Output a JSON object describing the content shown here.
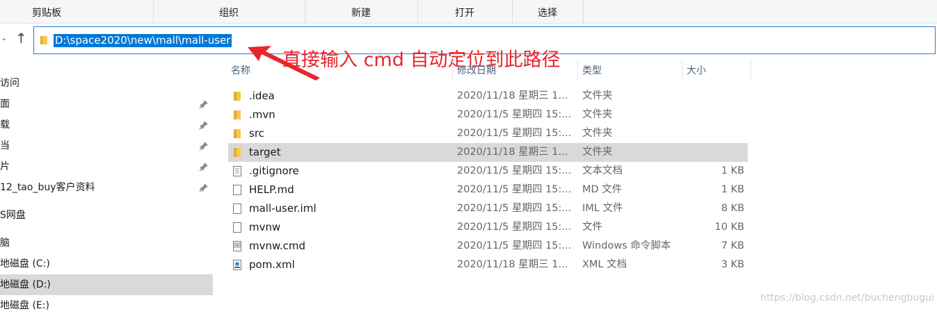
{
  "ribbon": {
    "groups": [
      "剪贴板",
      "组织",
      "新建",
      "打开",
      "选择"
    ]
  },
  "address": {
    "path": "D:\\space2020\\new\\mall\\mall-user"
  },
  "annotation": {
    "text": "直接输入 cmd 自动定位到此路径"
  },
  "sidebar": {
    "items": [
      {
        "label": "访问",
        "pinned": false,
        "icon": "quick-access-icon"
      },
      {
        "label": "面",
        "pinned": true,
        "icon": "desktop-icon"
      },
      {
        "label": "载",
        "pinned": true,
        "icon": "downloads-icon"
      },
      {
        "label": "当",
        "pinned": true,
        "icon": "documents-icon"
      },
      {
        "label": "片",
        "pinned": true,
        "icon": "pictures-icon"
      },
      {
        "label": "12_tao_buy客户资料",
        "pinned": true,
        "icon": "folder-icon"
      },
      {
        "label": "S网盘",
        "pinned": false,
        "icon": "cloud-drive-icon"
      },
      {
        "label": "脑",
        "pinned": false,
        "icon": "this-pc-icon"
      },
      {
        "label": "地磁盘 (C:)",
        "pinned": false,
        "icon": "drive-icon"
      },
      {
        "label": "地磁盘 (D:)",
        "pinned": false,
        "icon": "drive-icon",
        "selected": true
      },
      {
        "label": "地磁盘 (E:)",
        "pinned": false,
        "icon": "drive-icon"
      }
    ]
  },
  "columns": {
    "name": "名称",
    "date": "修改日期",
    "type": "类型",
    "size": "大小"
  },
  "files": [
    {
      "name": ".idea",
      "date": "2020/11/18 星期三 1...",
      "type": "文件夹",
      "size": "",
      "icon": "folder-icon"
    },
    {
      "name": ".mvn",
      "date": "2020/11/5 星期四 15:...",
      "type": "文件夹",
      "size": "",
      "icon": "folder-icon"
    },
    {
      "name": "src",
      "date": "2020/11/5 星期四 15:...",
      "type": "文件夹",
      "size": "",
      "icon": "folder-icon"
    },
    {
      "name": "target",
      "date": "2020/11/18 星期三 1...",
      "type": "文件夹",
      "size": "",
      "icon": "folder-icon",
      "selected": true
    },
    {
      "name": ".gitignore",
      "date": "2020/11/5 星期四 15:...",
      "type": "文本文档",
      "size": "1 KB",
      "icon": "text-file-icon"
    },
    {
      "name": "HELP.md",
      "date": "2020/11/5 星期四 15:...",
      "type": "MD 文件",
      "size": "1 KB",
      "icon": "file-icon"
    },
    {
      "name": "mall-user.iml",
      "date": "2020/11/5 星期四 15:...",
      "type": "IML 文件",
      "size": "8 KB",
      "icon": "file-icon"
    },
    {
      "name": "mvnw",
      "date": "2020/11/5 星期四 15:...",
      "type": "文件",
      "size": "10 KB",
      "icon": "file-icon"
    },
    {
      "name": "mvnw.cmd",
      "date": "2020/11/5 星期四 15:...",
      "type": "Windows 命令脚本",
      "size": "7 KB",
      "icon": "cmd-script-icon"
    },
    {
      "name": "pom.xml",
      "date": "2020/11/18 星期三 1...",
      "type": "XML 文档",
      "size": "3 KB",
      "icon": "xml-file-icon"
    }
  ],
  "watermark": "https://blog.csdn.net/buchengbugui",
  "colors": {
    "accent": "#0078d7",
    "annotation": "#e8262c",
    "selection": "#d9d9d9"
  }
}
